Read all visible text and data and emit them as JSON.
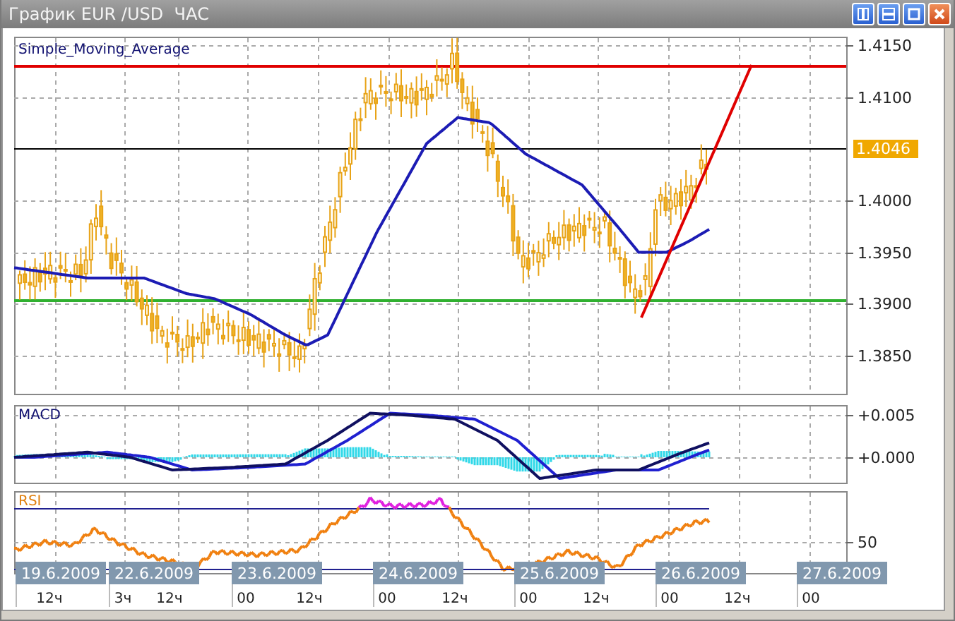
{
  "window": {
    "title": "График EUR /USD  ЧАС"
  },
  "main_panel": {
    "indicator_label": "Simple_Moving_Average",
    "price_axis": [
      "1.4150",
      "1.4100",
      "1.4000",
      "1.3950",
      "1.3900",
      "1.3850"
    ],
    "current_price": "1.4046"
  },
  "macd_panel": {
    "label": "MACD",
    "axis": [
      "+0.005",
      "+0.000"
    ]
  },
  "rsi_panel": {
    "label": "RSI",
    "axis": [
      "50"
    ]
  },
  "time_axis": {
    "dates": [
      "19.6.2009",
      "22.6.2009",
      "23.6.2009",
      "24.6.2009",
      "25.6.2009",
      "26.6.2009",
      "27.6.2009"
    ],
    "hours": [
      "12ч",
      "3ч",
      "12ч",
      "00",
      "12ч",
      "00",
      "12ч",
      "00",
      "12ч",
      "00",
      "12ч",
      "00"
    ]
  }
}
